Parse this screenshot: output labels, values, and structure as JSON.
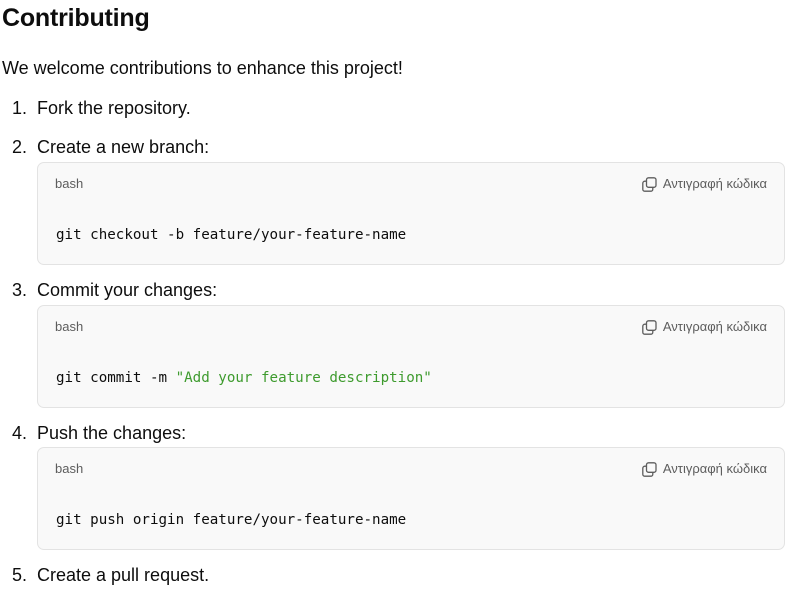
{
  "heading": "Contributing",
  "intro": "We welcome contributions to enhance this project!",
  "copy_label": "Αντιγραφή κώδικα",
  "steps": [
    {
      "num": "1.",
      "text": "Fork the repository."
    },
    {
      "num": "2.",
      "text": "Create a new branch:",
      "code": {
        "lang": "bash",
        "line": "git checkout -b feature/your-feature-name"
      }
    },
    {
      "num": "3.",
      "text": "Commit your changes:",
      "code": {
        "lang": "bash",
        "cmd": "git commit -m ",
        "string": "\"Add your feature description\""
      }
    },
    {
      "num": "4.",
      "text": "Push the changes:",
      "code": {
        "lang": "bash",
        "line": "git push origin feature/your-feature-name"
      }
    },
    {
      "num": "5.",
      "text": "Create a pull request."
    }
  ],
  "colors": {
    "code_background": "#f9f9f9",
    "code_border": "#e3e3e3",
    "string_token": "#3e9b2e",
    "muted_text": "#5d5d5d"
  },
  "icons": {
    "copy": "copy-icon"
  }
}
